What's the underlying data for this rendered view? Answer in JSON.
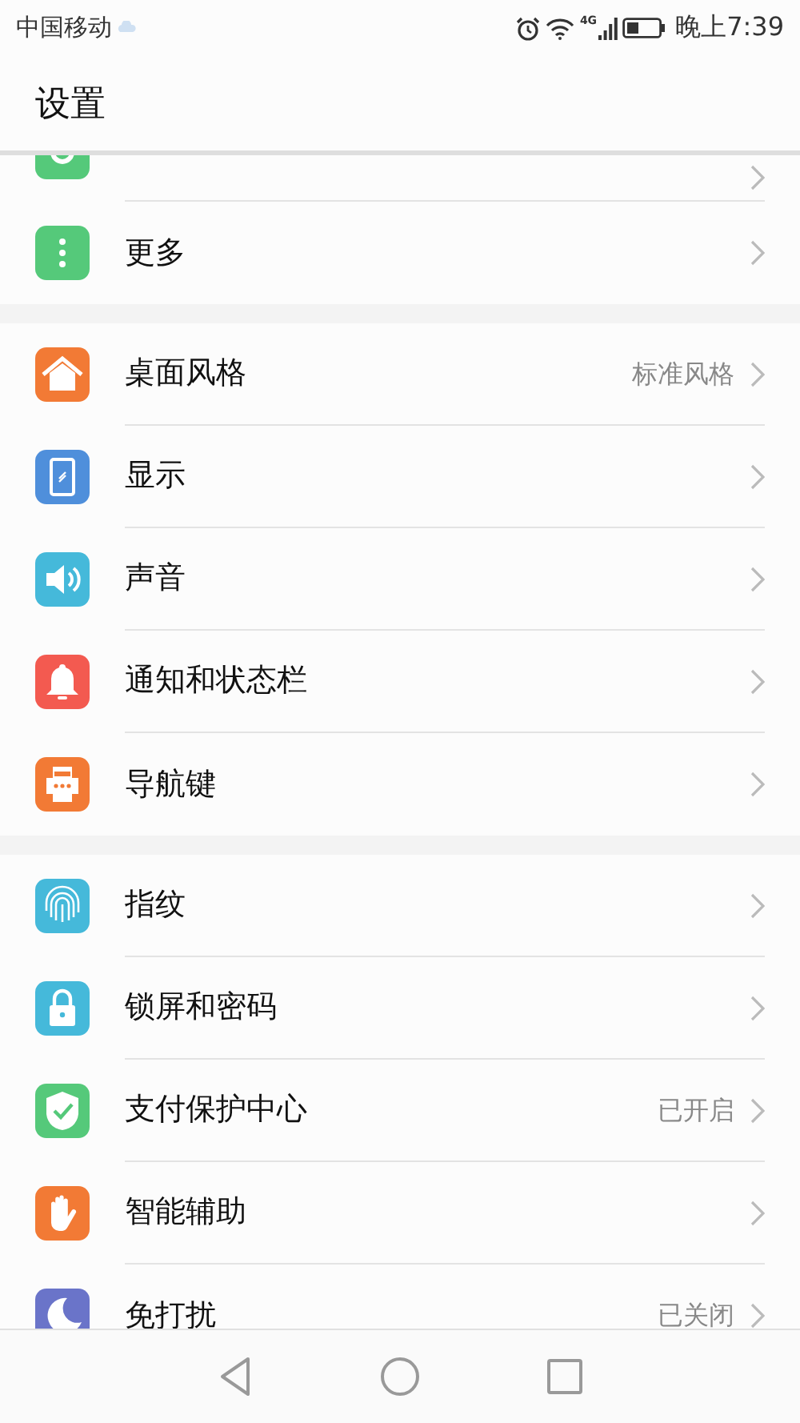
{
  "status_bar": {
    "carrier": "中国移动",
    "network": "4G",
    "time": "晚上7:39"
  },
  "header": {
    "title": "设置"
  },
  "groups": [
    {
      "items": [
        {
          "value": null,
          "color": "#55c97a",
          "partial": true
        },
        {
          "label": "更多",
          "value": null,
          "color": "#55c97a"
        }
      ]
    },
    {
      "items": [
        {
          "label": "桌面风格",
          "value": "标准风格",
          "color": "#f27a35"
        },
        {
          "label": "显示",
          "value": null,
          "color": "#4f8fdb"
        },
        {
          "label": "声音",
          "value": null,
          "color": "#45b9da"
        },
        {
          "label": "通知和状态栏",
          "value": null,
          "color": "#f35a50"
        },
        {
          "label": "导航键",
          "value": null,
          "color": "#f27a35"
        }
      ]
    },
    {
      "items": [
        {
          "label": "指纹",
          "value": null,
          "color": "#45b9da"
        },
        {
          "label": "锁屏和密码",
          "value": null,
          "color": "#45b9da"
        },
        {
          "label": "支付保护中心",
          "value": "已开启",
          "color": "#55c97a"
        },
        {
          "label": "智能辅助",
          "value": null,
          "color": "#f27a35"
        },
        {
          "label": "免打扰",
          "value": "已关闭",
          "color": "#6a74c9"
        }
      ]
    }
  ]
}
